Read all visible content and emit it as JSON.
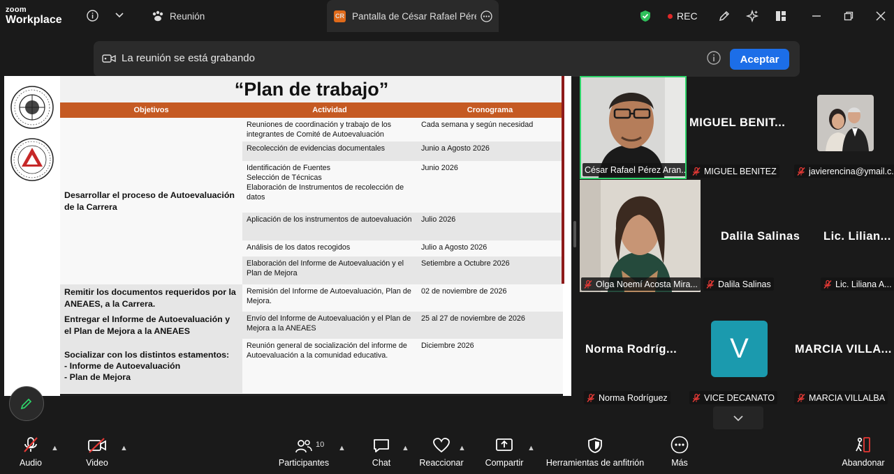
{
  "app": {
    "logo_top": "zoom",
    "logo_bottom": "Workplace"
  },
  "titlebar": {
    "tab_meeting": "Reunión",
    "tab_share": "Pantalla de César Rafael Pérez Ara",
    "share_badge": "CR",
    "rec_label": "REC"
  },
  "banner": {
    "text": "La reunión se está grabando",
    "accept": "Aceptar"
  },
  "slide": {
    "title": "“Plan de trabajo”",
    "headers": [
      "Objetivos",
      "Actividad",
      "Cronograma"
    ],
    "objectives": [
      "Desarrollar el proceso de Autoevaluación de la Carrera",
      "Remitir los documentos requeridos por la ANEAES, a la Carrera.",
      "Entregar el Informe de Autoevaluación y el Plan de Mejora a la ANEAES",
      "Socializar con los distintos estamentos:\n  - Informe de Autoevaluación\n  - Plan de Mejora"
    ],
    "rows": [
      {
        "activity": "Reuniones de coordinación y trabajo de los integrantes de Comité de Autoevaluación",
        "schedule": "Cada semana y según necesidad"
      },
      {
        "activity": "Recolección de evidencias documentales",
        "schedule": "Junio a Agosto 2026"
      },
      {
        "activity": "Identificación de Fuentes\nSelección de Técnicas\nElaboración de Instrumentos de recolección de datos",
        "schedule": "Junio 2026"
      },
      {
        "activity": "Aplicación de los instrumentos de autoevaluación",
        "schedule": "Julio 2026"
      },
      {
        "activity": "Análisis de los datos recogidos",
        "schedule": "Julio a Agosto 2026"
      },
      {
        "activity": "Elaboración del Informe de Autoevaluación y el Plan de Mejora",
        "schedule": "Setiembre a Octubre 2026"
      },
      {
        "activity": "Remisión del Informe de Autoevaluación, Plan de Mejora.",
        "schedule": "02 de noviembre de 2026"
      },
      {
        "activity": "Envío del Informe de Autoevaluación y el Plan de Mejora a la ANEAES",
        "schedule": "25 al 27 de noviembre de 2026"
      },
      {
        "activity": "Reunión general de socialización del informe de Autoevaluación a la comunidad educativa.",
        "schedule": "Diciembre 2026"
      }
    ]
  },
  "participants": {
    "cesar": {
      "tag": "César Rafael Pérez Aran..."
    },
    "miguel": {
      "big": "MIGUEL  BENIT...",
      "tag": "MIGUEL BENITEZ"
    },
    "javier": {
      "tag": "javierencina@ymail.c..."
    },
    "olga": {
      "tag": "Olga Noemí Acosta Mira..."
    },
    "dalila": {
      "big": "Dalila Salinas",
      "tag": "Dalila Salinas"
    },
    "liliana": {
      "big": "Lic.  Lilian...",
      "tag": "Lic. Liliana A..."
    },
    "norma": {
      "big": "Norma  Rodríg...",
      "tag": "Norma Rodríguez"
    },
    "vice": {
      "initial": "V",
      "tag": "VICE DECANATO"
    },
    "marcia": {
      "big": "MARCIA  VILLA...",
      "tag": "MARCIA VILLALBA"
    }
  },
  "toolbar": {
    "audio": "Audio",
    "video": "Video",
    "participants": "Participantes",
    "participants_count": "10",
    "chat": "Chat",
    "react": "Reaccionar",
    "share": "Compartir",
    "host_tools": "Herramientas de anfitrión",
    "more": "Más",
    "leave": "Abandonar"
  },
  "colors": {
    "accent": "#1c6ee8",
    "rec": "#e02828",
    "speaker": "#2ed46a",
    "slide_header": "#c55a23",
    "vice_avatar": "#1b9aae"
  }
}
